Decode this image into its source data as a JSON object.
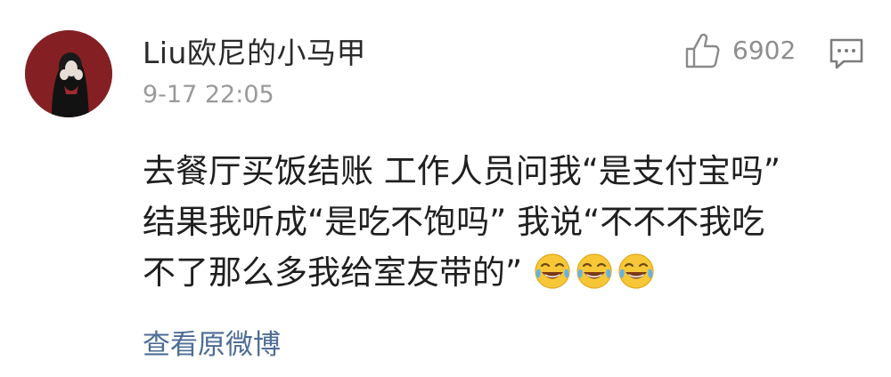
{
  "comment": {
    "username": "Liu欧尼的小马甲",
    "timestamp": "9-17 22:05",
    "like_count": "6902",
    "text_lines": [
      "去餐厅买饭结账  工作人员问我“是支付宝吗”",
      "结果我听成“是吃不饱吗”  我说“不不不我吃",
      "不了那么多我给室友带的”"
    ],
    "trailing_emojis": [
      "laugh-cry",
      "laugh-cry",
      "laugh-cry"
    ],
    "view_original_label": "查看原微博"
  },
  "icons": {
    "like": "thumbs-up-icon",
    "reply": "comment-bubble-icon"
  },
  "colors": {
    "username": "#2a2a2a",
    "timestamp": "#9a9a9a",
    "link": "#4d6c96",
    "avatar_bg": "#7a1f22"
  }
}
